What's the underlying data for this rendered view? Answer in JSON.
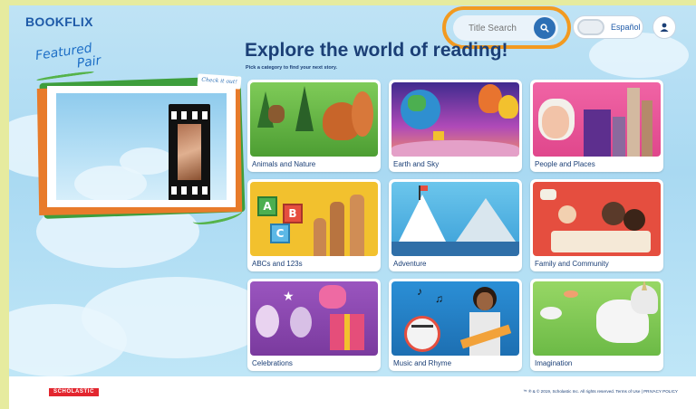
{
  "header": {
    "logo_main": "BOOKFLIX",
    "search_placeholder": "Title Search",
    "language_toggle_label": "Español"
  },
  "featured": {
    "title_line1": "Featured",
    "title_line2": "Pair",
    "check_it_out": "Check it out!"
  },
  "main": {
    "heading": "Explore the world of reading!",
    "subheading": "Pick a category to find your next story."
  },
  "categories": [
    {
      "label": "Animals and Nature",
      "color": "#6fbf4b"
    },
    {
      "label": "Earth and Sky",
      "color": "#5b3fa8"
    },
    {
      "label": "People and Places",
      "color": "#e85a9b"
    },
    {
      "label": "ABCs and 123s",
      "color": "#f2c12e"
    },
    {
      "label": "Adventure",
      "color": "#5cb8e6"
    },
    {
      "label": "Family and Community",
      "color": "#e54e3f"
    },
    {
      "label": "Celebrations",
      "color": "#8e4bb0"
    },
    {
      "label": "Music and Rhyme",
      "color": "#2b8fd6"
    },
    {
      "label": "Imagination",
      "color": "#8ed15a"
    }
  ],
  "footer": {
    "brand": "SCHOLASTIC",
    "copyright": "™ ® & © 2019, Scholastic Inc. All rights reserved.  Terms of Use | PRIVACY POLICY"
  },
  "colors": {
    "accent_highlight": "#f29a20",
    "brand_blue": "#1b3f76",
    "search_button": "#2c6fb5"
  }
}
